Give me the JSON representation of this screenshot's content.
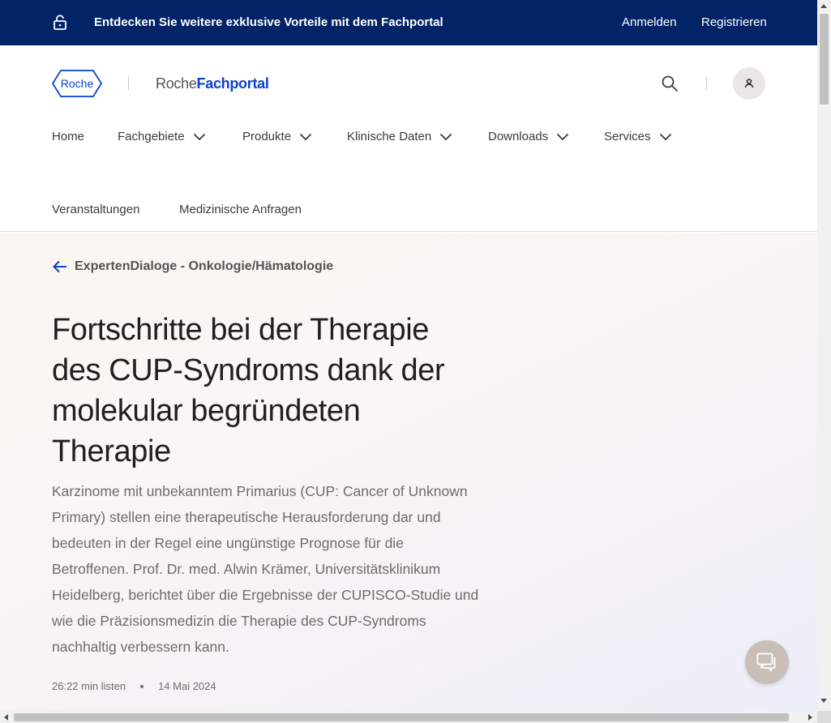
{
  "topbar": {
    "promo": "Entdecken Sie weitere exklusive Vorteile mit dem Fachportal",
    "login": "Anmelden",
    "register": "Registrieren",
    "icon": "unlock-icon",
    "background": "#022366"
  },
  "header": {
    "logo_text": "Roche",
    "portal_light": "Roche",
    "portal_bold": "Fachportal",
    "accent": "#0b41cd",
    "icons": [
      "search-icon",
      "user-icon"
    ]
  },
  "nav": {
    "items": [
      {
        "label": "Home",
        "has_dropdown": false
      },
      {
        "label": "Fachgebiete",
        "has_dropdown": true
      },
      {
        "label": "Produkte",
        "has_dropdown": true
      },
      {
        "label": "Klinische Daten",
        "has_dropdown": true
      },
      {
        "label": "Downloads",
        "has_dropdown": true
      },
      {
        "label": "Services",
        "has_dropdown": true
      },
      {
        "label": "Veranstaltungen",
        "has_dropdown": false
      },
      {
        "label": "Medizinische Anfragen",
        "has_dropdown": false
      }
    ]
  },
  "hero": {
    "back_label": "ExpertenDialoge - Onkologie/Hämatologie",
    "title": "Fortschritte bei der Therapie des CUP-Syndroms dank der molekular begründeten Therapie",
    "lead": "Karzinome mit unbekanntem Primarius (CUP: Cancer of Unknown Primary) stellen eine therapeutische Herausforderung dar und bedeuten in der Regel eine ungünstige Prognose für die Betroffenen. Prof. Dr. med. Alwin Krämer, Universitätsklinikum Heidelberg, berichtet über die Ergebnisse der CUPISCO-Studie und wie die Präzisionsmedizin die Therapie des CUP-Syndroms nachhaltig verbessern kann.",
    "duration": "26:22 min listen",
    "date": "14 Mai 2024"
  },
  "chat": {
    "icon": "chat-icon"
  }
}
